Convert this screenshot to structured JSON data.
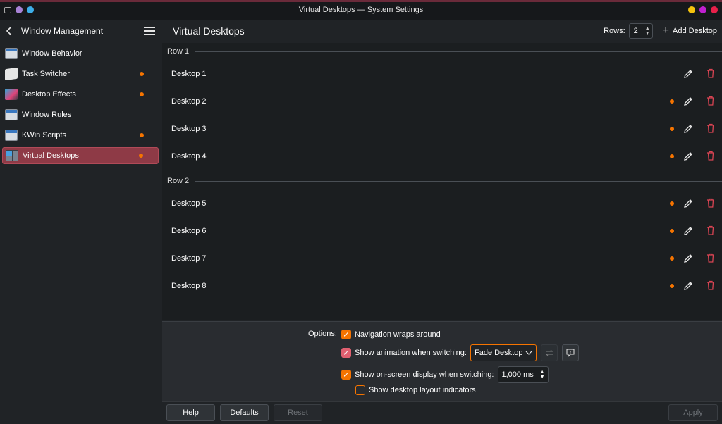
{
  "window": {
    "title": "Virtual Desktops — System Settings"
  },
  "sidebar": {
    "header_label": "Window Management",
    "items": [
      {
        "label": "Window Behavior",
        "icon": "window-icon",
        "modified": false,
        "active": false
      },
      {
        "label": "Task Switcher",
        "icon": "task-switcher-icon",
        "modified": true,
        "active": false
      },
      {
        "label": "Desktop Effects",
        "icon": "desktop-effects-icon",
        "modified": true,
        "active": false
      },
      {
        "label": "Window Rules",
        "icon": "window-rules-icon",
        "modified": false,
        "active": false
      },
      {
        "label": "KWin Scripts",
        "icon": "kwin-scripts-icon",
        "modified": true,
        "active": false
      },
      {
        "label": "Virtual Desktops",
        "icon": "virtual-desktops-icon",
        "modified": true,
        "active": true
      }
    ]
  },
  "header": {
    "title": "Virtual Desktops",
    "rows_label": "Rows:",
    "rows_value": "2",
    "add_label": "Add Desktop"
  },
  "rows": [
    {
      "label": "Row 1",
      "desktops": [
        {
          "name": "Desktop 1",
          "modified": false
        },
        {
          "name": "Desktop 2",
          "modified": true
        },
        {
          "name": "Desktop 3",
          "modified": true
        },
        {
          "name": "Desktop 4",
          "modified": true
        }
      ]
    },
    {
      "label": "Row 2",
      "desktops": [
        {
          "name": "Desktop 5",
          "modified": true
        },
        {
          "name": "Desktop 6",
          "modified": true
        },
        {
          "name": "Desktop 7",
          "modified": true
        },
        {
          "name": "Desktop 8",
          "modified": true
        }
      ]
    }
  ],
  "options": {
    "label": "Options:",
    "nav_wraps": "Navigation wraps around",
    "show_animation": "Show animation when switching:",
    "animation_value": "Fade Desktop",
    "show_osd": "Show on-screen display when switching:",
    "osd_duration": "1,000 ms",
    "show_layout": "Show desktop layout indicators"
  },
  "footer": {
    "help": "Help",
    "defaults": "Defaults",
    "reset": "Reset",
    "apply": "Apply"
  },
  "colors": {
    "accent": "#f67400",
    "active_item": "#8e3a46",
    "delete": "#da4453",
    "background": "#202326"
  }
}
